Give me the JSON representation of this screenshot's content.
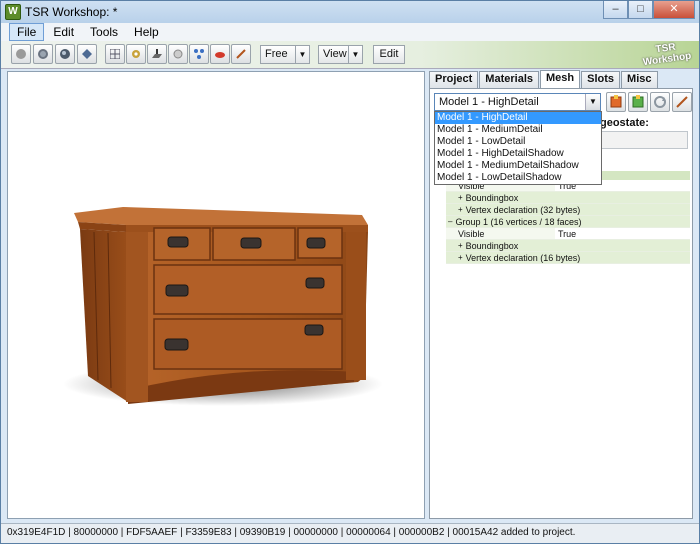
{
  "window": {
    "title": "TSR Workshop: *",
    "app_icon_letter": "W",
    "minimize": "–",
    "maximize": "□",
    "close": "✕"
  },
  "menu": [
    "File",
    "Edit",
    "Tools",
    "Help"
  ],
  "toolbar": {
    "camera_mode": "Free",
    "view": "View",
    "edit": "Edit",
    "logo_line1": "TSR",
    "logo_line2": "Workshop"
  },
  "tabs": [
    "Project",
    "Materials",
    "Mesh",
    "Slots",
    "Misc"
  ],
  "selected_tab": "Mesh",
  "mesh": {
    "model_selected": "Model 1 - HighDetail",
    "geostate_label": "geostate:",
    "model_options": [
      "Model 1 - HighDetail",
      "Model 1 - MediumDetail",
      "Model 1 - LowDetail",
      "Model 1 - HighDetailShadow",
      "Model 1 - MediumDetailShadow",
      "Model 1 - LowDetailShadow"
    ],
    "tree": {
      "group0_visible_key": "Visible",
      "group0_visible_value": "True",
      "group0_boundingbox": "Boundingbox",
      "group0_vertex_decl": "Vertex declaration (32 bytes)",
      "group1_label": "Group 1 (16 vertices / 18 faces)",
      "group1_visible_key": "Visible",
      "group1_visible_value": "True",
      "group1_boundingbox": "Boundingbox",
      "group1_vertex_decl": "Vertex declaration (16 bytes)",
      "expand_symbol": "+",
      "collapse_symbol": "–"
    }
  },
  "status": "0x319E4F1D | 80000000 | FDF5AAEF | F3359E83 | 09390B19 | 00000000 | 00000064 | 000000B2 | 00015A42 added to project.",
  "colors": {
    "wood": "#a8581e",
    "wood_dark": "#6e3510",
    "wood_light": "#c9763a",
    "accent_green": "#b8d495",
    "selection_blue": "#3399ff"
  }
}
